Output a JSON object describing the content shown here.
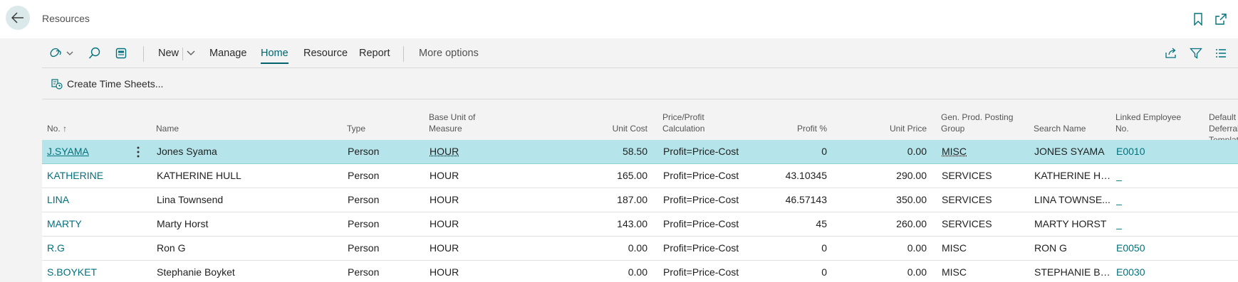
{
  "header": {
    "title": "Resources"
  },
  "actionbar": {
    "new_label": "New",
    "tabs": [
      "Manage",
      "Home",
      "Resource",
      "Report"
    ],
    "active_tab": "Home",
    "more_options": "More options"
  },
  "subbar": {
    "create_time_sheets": "Create Time Sheets..."
  },
  "table": {
    "columns": {
      "no": "No. ↑",
      "name": "Name",
      "type": "Type",
      "base_uom_1": "Base Unit of",
      "base_uom_2": "Measure",
      "unit_cost": "Unit Cost",
      "price_calc_1": "Price/Profit",
      "price_calc_2": "Calculation",
      "profit_pct": "Profit %",
      "unit_price": "Unit Price",
      "gen_prod_1": "Gen. Prod. Posting",
      "gen_prod_2": "Group",
      "search_name": "Search Name",
      "linked_emp_1": "Linked Employee",
      "linked_emp_2": "No.",
      "deferral_1": "Default Deferral",
      "deferral_2": "Template"
    },
    "rows": [
      {
        "no": "J.SYAMA",
        "name": "Jones Syama",
        "type": "Person",
        "uom": "HOUR",
        "unit_cost": "58.50",
        "calc": "Profit=Price-Cost",
        "profit": "0",
        "unit_price": "0.00",
        "group": "MISC",
        "search": "JONES SYAMA",
        "employee": "E0010"
      },
      {
        "no": "KATHERINE",
        "name": "KATHERINE HULL",
        "type": "Person",
        "uom": "HOUR",
        "unit_cost": "165.00",
        "calc": "Profit=Price-Cost",
        "profit": "43.10345",
        "unit_price": "290.00",
        "group": "SERVICES",
        "search": "KATHERINE HULL",
        "employee": "_"
      },
      {
        "no": "LINA",
        "name": "Lina Townsend",
        "type": "Person",
        "uom": "HOUR",
        "unit_cost": "187.00",
        "calc": "Profit=Price-Cost",
        "profit": "46.57143",
        "unit_price": "350.00",
        "group": "SERVICES",
        "search": "LINA TOWNSE...",
        "employee": "_"
      },
      {
        "no": "MARTY",
        "name": "Marty Horst",
        "type": "Person",
        "uom": "HOUR",
        "unit_cost": "143.00",
        "calc": "Profit=Price-Cost",
        "profit": "45",
        "unit_price": "260.00",
        "group": "SERVICES",
        "search": "MARTY HORST",
        "employee": "_"
      },
      {
        "no": "R.G",
        "name": "Ron G",
        "type": "Person",
        "uom": "HOUR",
        "unit_cost": "0.00",
        "calc": "Profit=Price-Cost",
        "profit": "0",
        "unit_price": "0.00",
        "group": "MISC",
        "search": "RON G",
        "employee": "E0050"
      },
      {
        "no": "S.BOYKET",
        "name": "Stephanie Boyket",
        "type": "Person",
        "uom": "HOUR",
        "unit_cost": "0.00",
        "calc": "Profit=Price-Cost",
        "profit": "0",
        "unit_price": "0.00",
        "group": "MISC",
        "search": "STEPHANIE BO...",
        "employee": "E0030"
      }
    ]
  },
  "colors": {
    "accent": "#00727d",
    "selected_row": "#b5e5ea",
    "back_button": "#dbe9eb"
  }
}
